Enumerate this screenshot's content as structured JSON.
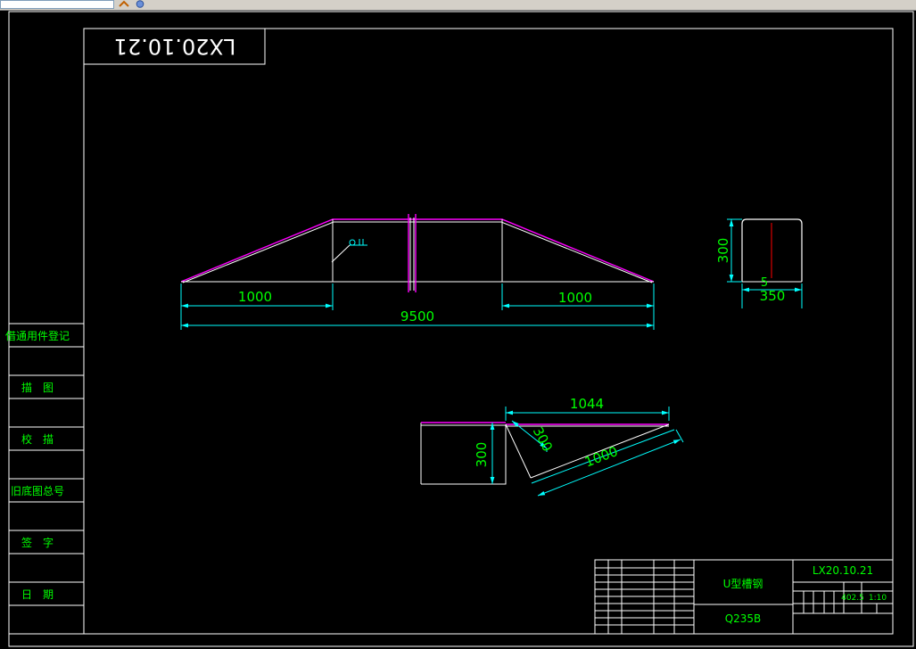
{
  "window": {
    "toolbar_icons": [
      "paint-icon",
      "globe-icon"
    ]
  },
  "drawing": {
    "code_stamp": "LX20.10.21",
    "front_view": {
      "dim_left": "1000",
      "dim_right": "1000",
      "dim_total": "9500"
    },
    "section_view": {
      "dim_height": "300",
      "dim_inner": "5",
      "dim_width": "350"
    },
    "detail_view": {
      "dim_top": "1044",
      "dim_height": "300",
      "dim_slant_short": "300",
      "dim_slant_long": "1000"
    },
    "side_table": [
      "借通用件登记",
      "描　图",
      "校　描",
      "旧底图总号",
      "签　字",
      "日　期"
    ],
    "title_block": {
      "part_name": "U型槽钢",
      "material": "Q235B",
      "drawing_no": "LX20.10.21",
      "weight": "402.5",
      "scale": "1:10"
    }
  },
  "colors": {
    "line": "#ffffff",
    "dim": "#00ffff",
    "text": "#00ff00",
    "magenta": "#ff00ff",
    "red": "#ff0000"
  }
}
